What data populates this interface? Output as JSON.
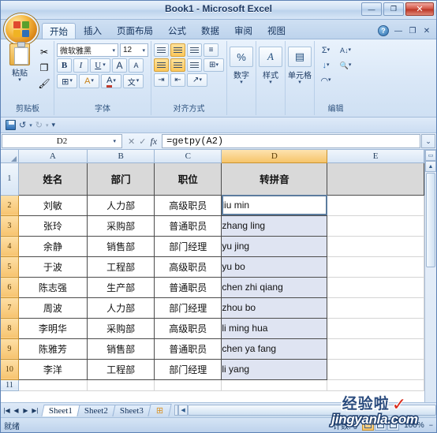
{
  "window": {
    "title": "Book1 - Microsoft Excel",
    "minimize": "—",
    "restore": "❐",
    "close": "✕"
  },
  "ribbon": {
    "tabs": [
      {
        "label": "开始",
        "active": true
      },
      {
        "label": "插入",
        "active": false
      },
      {
        "label": "页面布局",
        "active": false
      },
      {
        "label": "公式",
        "active": false
      },
      {
        "label": "数据",
        "active": false
      },
      {
        "label": "审阅",
        "active": false
      },
      {
        "label": "视图",
        "active": false
      }
    ],
    "help_icon": "?",
    "doc_minimize": "—",
    "doc_restore": "❐",
    "doc_close": "✕",
    "groups": {
      "clipboard": {
        "label": "剪贴板",
        "paste": "粘贴",
        "caret": "▾",
        "cut_icon": "✂",
        "copy_icon": "❐",
        "painter_icon": "🖌"
      },
      "font": {
        "label": "字体",
        "font_name": "微软雅黑",
        "font_size": "12",
        "bold": "B",
        "italic": "I",
        "underline": "U",
        "grow": "A",
        "shrink": "A",
        "borders_icon": "⊞",
        "fill_icon": "A",
        "color_icon": "A",
        "phonetic_icon": "文",
        "caret": "▾"
      },
      "alignment": {
        "label": "对齐方式",
        "wrap_icon": "≡",
        "merge_icon": "⊞",
        "indent_dec": "⇥",
        "indent_inc": "⇤",
        "orient_icon": "↗",
        "caret": "▾"
      },
      "number": {
        "label": "数字",
        "icon": "%",
        "caret": "▾"
      },
      "styles": {
        "label": "样式",
        "icon": "A",
        "caret": "▾"
      },
      "cells": {
        "label": "单元格",
        "icon": "▤",
        "caret": "▾"
      },
      "editing": {
        "label": "编辑",
        "sum_icon": "Σ",
        "sort_icon": "A↓",
        "fill_icon": "↓",
        "find_icon": "🔍",
        "clear_icon": "◠",
        "caret": "▾"
      }
    }
  },
  "quick_access": {
    "save_icon": "save-icon",
    "undo_icon": "↺",
    "redo_icon": "↻",
    "customize_icon": "▾",
    "caret": "▾"
  },
  "formula_bar": {
    "name_box": "D2",
    "name_caret": "▾",
    "cancel_icon": "✕",
    "accept_icon": "✓",
    "fx_label": "fx",
    "formula": "=getpy(A2)",
    "expand_icon": "⌄"
  },
  "grid": {
    "columns": [
      "A",
      "B",
      "C",
      "D",
      "E"
    ],
    "selected_column": "D",
    "rows": [
      "1",
      "2",
      "3",
      "4",
      "5",
      "6",
      "7",
      "8",
      "9",
      "10",
      "11"
    ],
    "selected_rows": [
      "2",
      "3",
      "4",
      "5",
      "6",
      "7",
      "8",
      "9",
      "10"
    ],
    "active_cell": "D2",
    "headers": [
      "姓名",
      "部门",
      "职位",
      "转拼音"
    ],
    "data": [
      {
        "row": "2",
        "name": "刘敏",
        "dept": "人力部",
        "title": "高级职员",
        "pinyin": "liu min"
      },
      {
        "row": "3",
        "name": "张玲",
        "dept": "采购部",
        "title": "普通职员",
        "pinyin": "zhang ling"
      },
      {
        "row": "4",
        "name": "余静",
        "dept": "销售部",
        "title": "部门经理",
        "pinyin": "yu jing"
      },
      {
        "row": "5",
        "name": "于波",
        "dept": "工程部",
        "title": "高级职员",
        "pinyin": "yu bo"
      },
      {
        "row": "6",
        "name": "陈志强",
        "dept": "生产部",
        "title": "普通职员",
        "pinyin": "chen zhi qiang"
      },
      {
        "row": "7",
        "name": "周波",
        "dept": "人力部",
        "title": "部门经理",
        "pinyin": "zhou bo"
      },
      {
        "row": "8",
        "name": "李明华",
        "dept": "采购部",
        "title": "高级职员",
        "pinyin": "li ming hua"
      },
      {
        "row": "9",
        "name": "陈雅芳",
        "dept": "销售部",
        "title": "普通职员",
        "pinyin": "chen ya fang"
      },
      {
        "row": "10",
        "name": "李洋",
        "dept": "工程部",
        "title": "部门经理",
        "pinyin": "li yang"
      }
    ]
  },
  "sheet_tabs": {
    "first_icon": "|◀",
    "prev_icon": "◀",
    "next_icon": "▶",
    "last_icon": "▶|",
    "tabs": [
      {
        "label": "Sheet1",
        "active": true
      },
      {
        "label": "Sheet2",
        "active": false
      },
      {
        "label": "Sheet3",
        "active": false
      }
    ],
    "new_sheet_icon": "⊞"
  },
  "status_bar": {
    "ready": "就绪",
    "count": "计数: 9",
    "view_normal": "normal-view-icon",
    "view_layout": "page-layout-icon",
    "view_break": "page-break-icon",
    "zoom": "100%",
    "zoom_out": "−"
  },
  "watermark": {
    "cn": "经验啦",
    "check": "✓",
    "url": "jingyanla.com"
  }
}
